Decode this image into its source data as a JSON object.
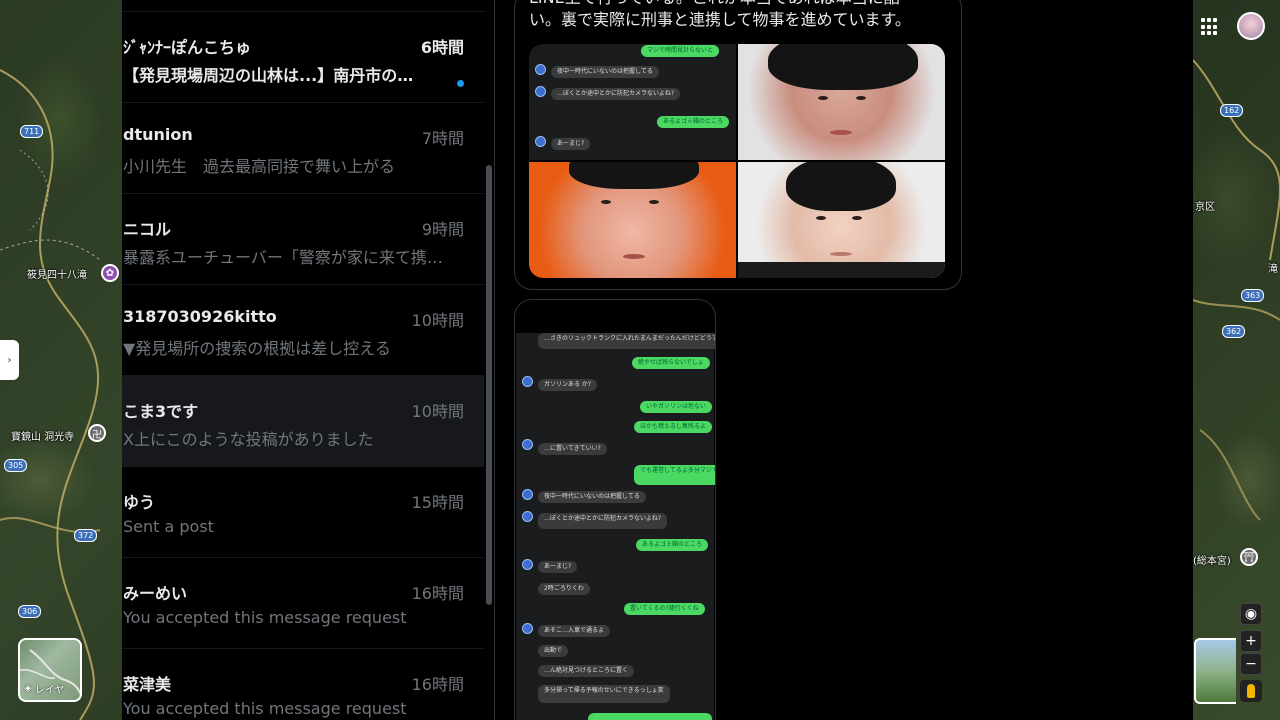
{
  "map": {
    "labels": [
      "筱見四十八滝",
      "寶鏡山 洞光寺",
      "京区",
      "滝",
      "(総本宮)"
    ],
    "road_numbers": [
      "711",
      "305",
      "372",
      "306",
      "162",
      "363",
      "362"
    ],
    "layers_label": "レイヤ",
    "side_toggle": "›"
  },
  "dm_list": [
    {
      "name": "ｼﾞｬﾝﾅｰぽんこちゅ",
      "time": "6時間",
      "preview": "【発見現場周辺の山林は...】南丹市の…",
      "unread": true,
      "selected": false
    },
    {
      "name": "dtunion",
      "time": "7時間",
      "preview": "小川先生　過去最高同接で舞い上がる",
      "unread": false,
      "selected": false
    },
    {
      "name": "ニコル",
      "time": "9時間",
      "preview": "暴露系ユーチューバー「警察が家に来て携…",
      "unread": false,
      "selected": false
    },
    {
      "name": "3187030926kitto",
      "time": "10時間",
      "preview": "▼発見場所の捜索の根拠は差し控える",
      "unread": false,
      "selected": false
    },
    {
      "name": "こま3です",
      "time": "10時間",
      "preview": "X上にこのような投稿がありました",
      "unread": false,
      "selected": true
    },
    {
      "name": "ゆう",
      "time": "15時間",
      "preview": "Sent a post",
      "unread": false,
      "selected": false
    },
    {
      "name": "みーめい",
      "time": "16時間",
      "preview": "You accepted this message request",
      "unread": false,
      "selected": false
    },
    {
      "name": "菜津美",
      "time": "16時間",
      "preview": "You accepted this message request",
      "unread": false,
      "selected": false
    }
  ],
  "conversation": {
    "message_text_line1": "LINE上で行っている。これが本当であれば本当に酷",
    "message_text_line2": "い。裏で実際に刑事と連携して物事を進めています。",
    "chat_tile_rows": [
      {
        "dir": "out",
        "text": "マジで時間見計らないと"
      },
      {
        "dir": "in",
        "text": "夜中一時代にいないのは把握してる"
      },
      {
        "dir": "in",
        "text": "…ぼくとか途中とかに防犯カメラないよね?"
      },
      {
        "dir": "out",
        "text": "あるよゴミ箱のところ"
      },
      {
        "dir": "in",
        "text": "あーまじ?"
      }
    ],
    "phone_chat_rows": [
      {
        "dir": "in",
        "text": "…さきのリュックトランクに入れたまんまだったんだけどどうすればいい?"
      },
      {
        "dir": "out",
        "text": "絶やせば残らないでしょ"
      },
      {
        "dir": "in",
        "text": "ガソリンある か?"
      },
      {
        "dir": "out",
        "text": "いやガソリンは危ない"
      },
      {
        "dir": "out",
        "text": "ほかも燃えるし臭残るよ"
      },
      {
        "dir": "in",
        "text": "…に置いてきていい?"
      },
      {
        "dir": "out",
        "text": "でも運営してるよ多分マジで時間見計らないと"
      },
      {
        "dir": "in",
        "text": "夜中一時代にいないのは把握してる"
      },
      {
        "dir": "in",
        "text": "…ぼくとか途中とかに防犯カメラないよね?"
      },
      {
        "dir": "out",
        "text": "あるよゴミ箱のところ"
      },
      {
        "dir": "in",
        "text": "あーまじ?"
      },
      {
        "dir": "in",
        "text": "2時ごろりくわ"
      },
      {
        "dir": "out",
        "text": "置いてくるの?随行くくね"
      },
      {
        "dir": "in",
        "text": "あそこ…入車で通るよ"
      },
      {
        "dir": "in",
        "text": "出動で"
      },
      {
        "dir": "in",
        "text": "…ん絶対見つけるところに置く"
      },
      {
        "dir": "in",
        "text": "多分掃って帰る予報のせいにできるっしょ笑"
      }
    ]
  },
  "colors": {
    "accent_blue": "#1d9bf0",
    "panel_bg": "#000000",
    "line_green": "#4bd964"
  }
}
